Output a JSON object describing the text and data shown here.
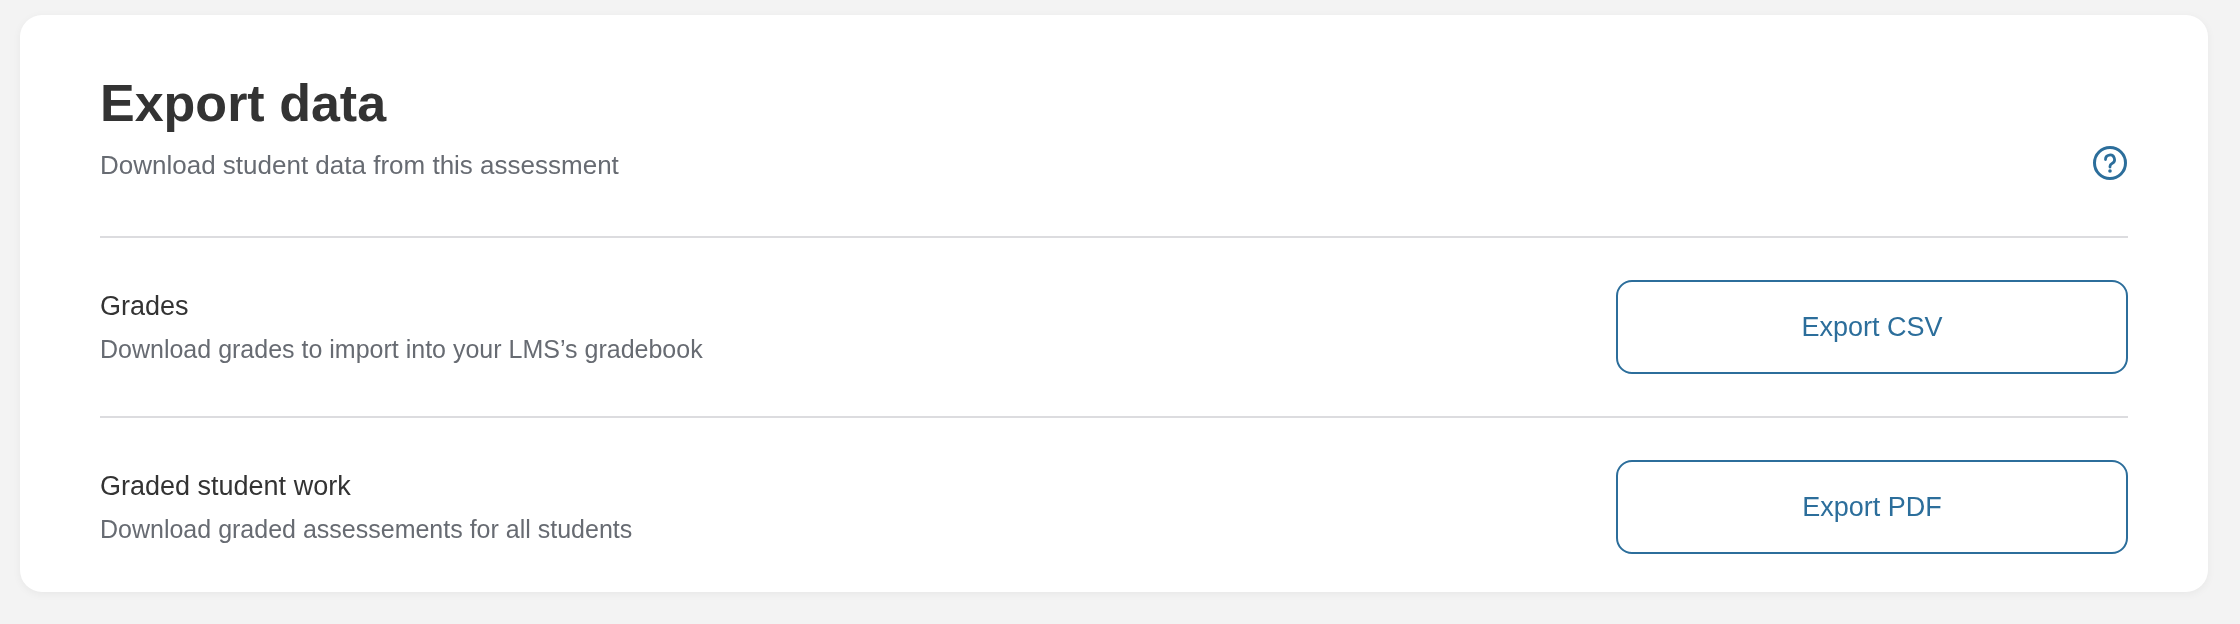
{
  "header": {
    "title": "Export data",
    "subtitle": "Download student data from this assessment"
  },
  "rows": [
    {
      "title": "Grades",
      "description": "Download grades to import into your LMS’s gradebook",
      "button": "Export CSV"
    },
    {
      "title": "Graded student work",
      "description": "Download graded assessements for all students",
      "button": "Export PDF"
    }
  ]
}
